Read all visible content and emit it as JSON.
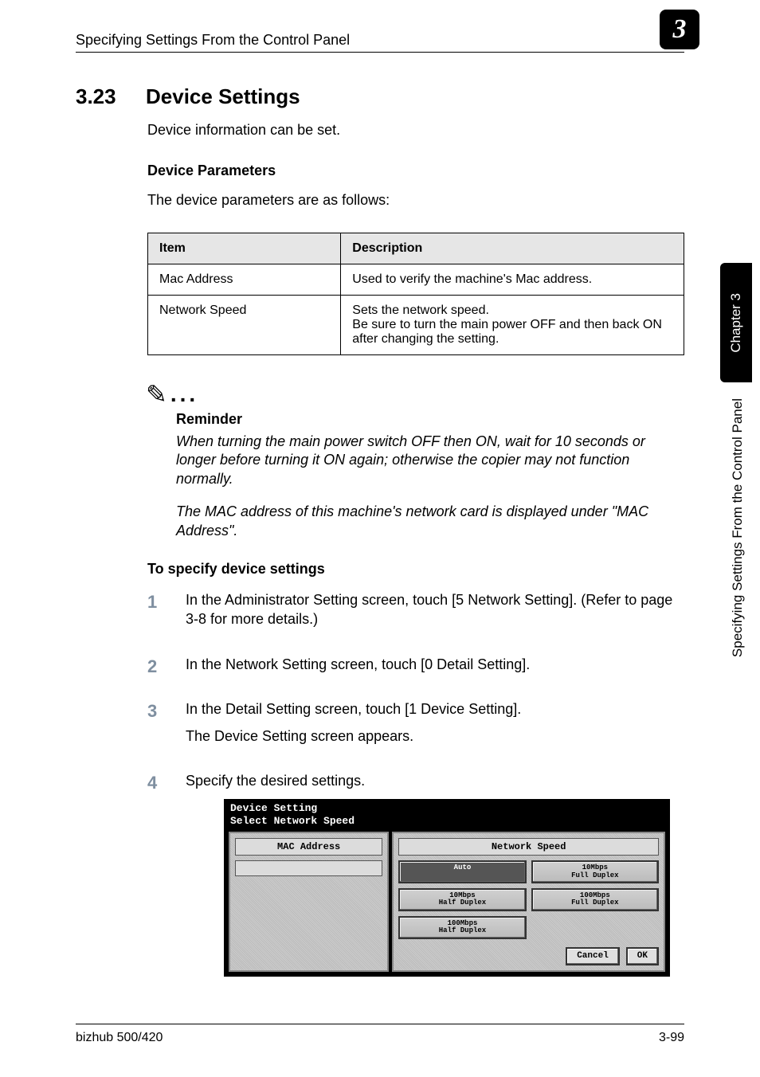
{
  "header": {
    "title": "Specifying Settings From the Control Panel",
    "chapter_badge": "3"
  },
  "section": {
    "number": "3.23",
    "title": "Device Settings",
    "intro": "Device information can be set."
  },
  "device_parameters": {
    "heading": "Device Parameters",
    "intro": "The device parameters are as follows:",
    "columns": {
      "item": "Item",
      "description": "Description"
    },
    "rows": [
      {
        "item": "Mac Address",
        "description": "Used to verify the machine's Mac address."
      },
      {
        "item": "Network Speed",
        "description": "Sets the network speed.\nBe sure to turn the main power OFF and then back ON after changing the setting."
      }
    ]
  },
  "reminder": {
    "heading": "Reminder",
    "paragraphs": [
      "When turning the main power switch OFF then ON, wait for 10 seconds or longer before turning it ON again; otherwise the copier may not function normally.",
      "The MAC address of this machine's network card is displayed under \"MAC Address\"."
    ]
  },
  "procedure": {
    "heading": "To specify device settings",
    "steps": [
      {
        "n": "1",
        "text": "In the Administrator Setting screen, touch [5 Network Setting]. (Refer to page 3-8 for more details.)"
      },
      {
        "n": "2",
        "text": "In the Network Setting screen, touch [0 Detail Setting]."
      },
      {
        "n": "3",
        "text": "In the Detail Setting screen, touch [1 Device Setting].",
        "subtext": "The Device Setting screen appears."
      },
      {
        "n": "4",
        "text": "Specify the desired settings."
      }
    ]
  },
  "device_panel": {
    "title": "Device Setting",
    "subtitle": "Select Network Speed",
    "mac_label": "MAC Address",
    "speed_label": "Network Speed",
    "buttons": {
      "auto": "Auto",
      "ten_full": "10Mbps\nFull Duplex",
      "ten_half": "10Mbps\nHalf Duplex",
      "hund_full": "100Mbps\nFull Duplex",
      "hund_half": "100Mbps\nHalf Duplex"
    },
    "cancel": "Cancel",
    "ok": "OK"
  },
  "side": {
    "tab": "Chapter 3",
    "text": "Specifying Settings From the Control Panel"
  },
  "footer": {
    "left": "bizhub 500/420",
    "right": "3-99"
  }
}
